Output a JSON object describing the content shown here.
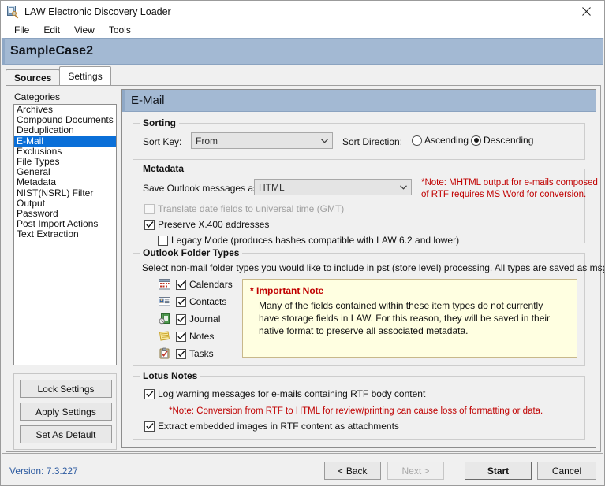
{
  "window": {
    "title": "LAW Electronic Discovery Loader",
    "icon": "document-search-icon",
    "close_label": "close-icon"
  },
  "menubar": {
    "items": [
      {
        "label": "File"
      },
      {
        "label": "Edit"
      },
      {
        "label": "View"
      },
      {
        "label": "Tools"
      }
    ]
  },
  "case_banner": {
    "title": "SampleCase2"
  },
  "tabs": [
    {
      "label": "Sources",
      "selected": false
    },
    {
      "label": "Settings",
      "selected": true
    }
  ],
  "categories": {
    "label": "Categories",
    "items": [
      {
        "label": "Archives",
        "selected": false
      },
      {
        "label": "Compound Documents",
        "selected": false
      },
      {
        "label": "Deduplication",
        "selected": false
      },
      {
        "label": "E-Mail",
        "selected": true
      },
      {
        "label": "Exclusions",
        "selected": false
      },
      {
        "label": "File Types",
        "selected": false
      },
      {
        "label": "General",
        "selected": false
      },
      {
        "label": "Metadata",
        "selected": false
      },
      {
        "label": "NIST(NSRL) Filter",
        "selected": false
      },
      {
        "label": "Output",
        "selected": false
      },
      {
        "label": "Password",
        "selected": false
      },
      {
        "label": "Post Import Actions",
        "selected": false
      },
      {
        "label": "Text Extraction",
        "selected": false
      }
    ]
  },
  "left_buttons": [
    {
      "label": "Lock Settings"
    },
    {
      "label": "Apply Settings"
    },
    {
      "label": "Set As Default"
    }
  ],
  "panel": {
    "title": "E-Mail",
    "sorting": {
      "title": "Sorting",
      "sort_key_label": "Sort Key:",
      "sort_key_value": "From",
      "sort_direction_label": "Sort Direction:",
      "ascending_label": "Ascending",
      "descending_label": "Descending",
      "selected_direction": "Descending"
    },
    "metadata": {
      "title": "Metadata",
      "save_as_label": "Save Outlook messages as:",
      "save_as_value": "HTML",
      "note_line1": "*Note:  MHTML output for e-mails composed",
      "note_line2": "of RTF requires MS Word for conversion.",
      "checkboxes": [
        {
          "label": "Translate date fields to universal time (GMT)",
          "checked": false,
          "disabled": true
        },
        {
          "label": "Preserve X.400 addresses",
          "checked": true,
          "disabled": false
        },
        {
          "label": "Legacy Mode (produces hashes compatible with LAW 6.2 and lower)",
          "checked": false,
          "disabled": false
        }
      ]
    },
    "outlook_folder_types": {
      "title": "Outlook Folder Types",
      "description": "Select non-mail folder types you would like to include in pst (store level) processing.  All types are saved as msg/rtf",
      "items": [
        {
          "label": "Calendars",
          "checked": true,
          "icon": "calendar-icon"
        },
        {
          "label": "Contacts",
          "checked": true,
          "icon": "contact-card-icon"
        },
        {
          "label": "Journal",
          "checked": true,
          "icon": "journal-icon"
        },
        {
          "label": "Notes",
          "checked": true,
          "icon": "notes-icon"
        },
        {
          "label": "Tasks",
          "checked": true,
          "icon": "tasks-clipboard-icon"
        }
      ],
      "note_box": {
        "title": "* Important Note",
        "body": "Many of the fields contained within these item types do not currently have storage fields in LAW. For this reason, they will be saved in their native format to preserve all associated metadata."
      }
    },
    "lotus_notes": {
      "title": "Lotus Notes",
      "checkbox1": {
        "label": "Log warning messages for e-mails containing RTF body content",
        "checked": true
      },
      "note": "*Note:  Conversion from RTF to HTML for review/printing can cause loss of formatting or data.",
      "checkbox2": {
        "label": "Extract embedded images in RTF content as attachments",
        "checked": true
      }
    }
  },
  "footer": {
    "version": "Version: 7.3.227",
    "buttons": [
      {
        "label": "< Back",
        "disabled": false,
        "default": false
      },
      {
        "label": "Next >",
        "disabled": true,
        "default": false
      },
      {
        "label": "Start",
        "disabled": false,
        "default": true
      },
      {
        "label": "Cancel",
        "disabled": false,
        "default": false
      }
    ]
  },
  "colors": {
    "banner": "#a3b9d3",
    "selection": "#0a6fd8",
    "note_red": "#c00000",
    "version_blue": "#2c5aa0",
    "note_box_bg": "#ffffe1"
  }
}
